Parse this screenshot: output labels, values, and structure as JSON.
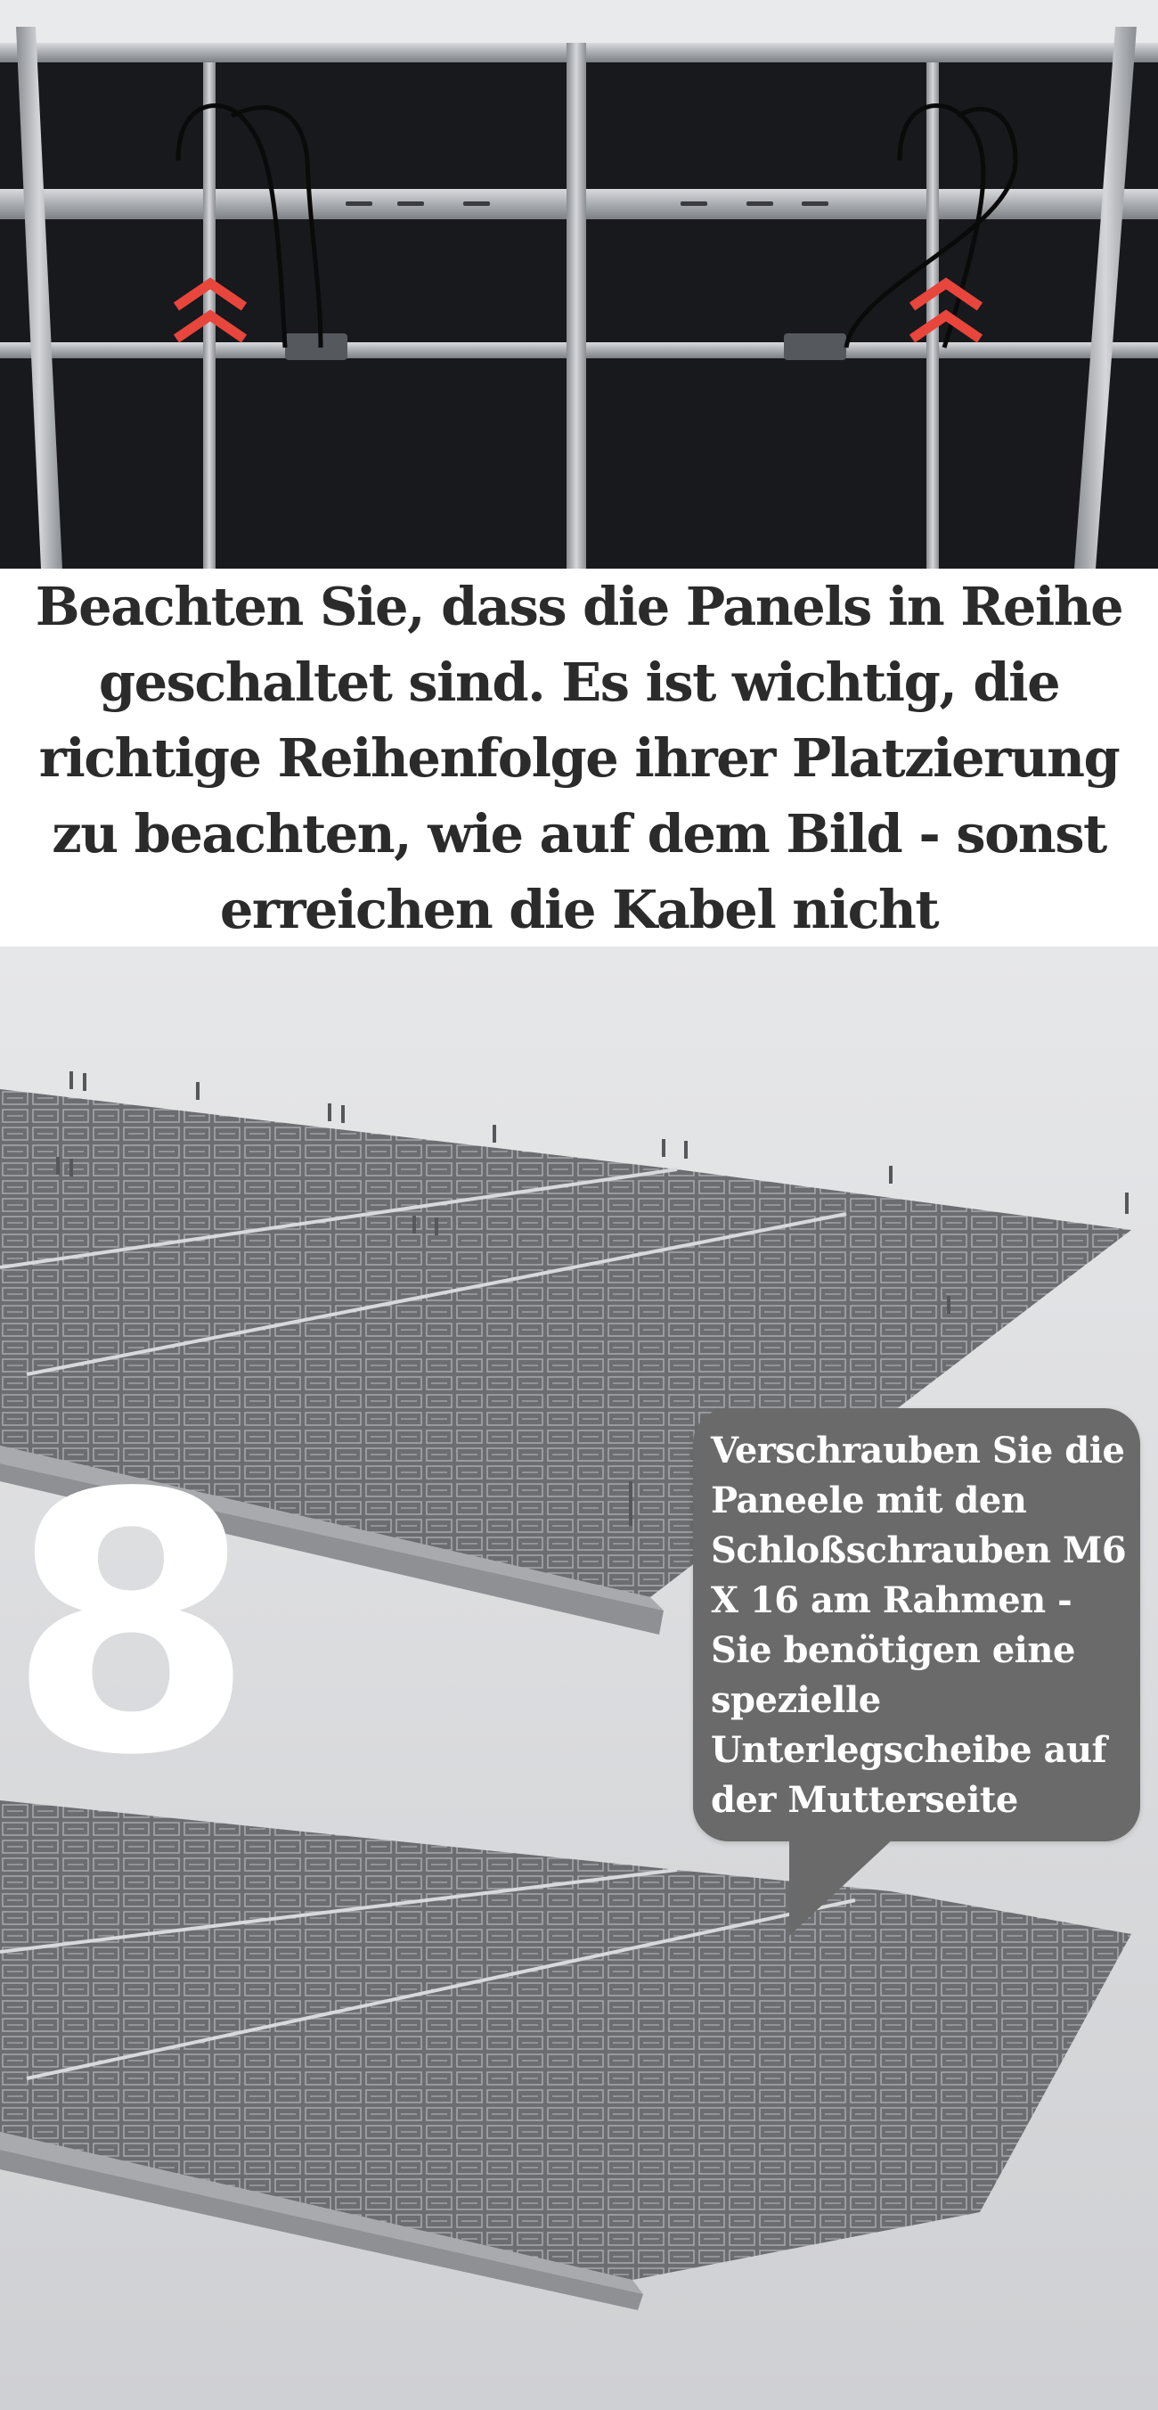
{
  "caption": {
    "text": "Beachten Sie, dass die Panels in Reihe geschaltet sind. Es ist wichtig, die richtige Reihenfolge ihrer Platzierung zu beachten, wie auf dem Bild - sonst erreichen die Kabel nicht"
  },
  "step": {
    "number": "8",
    "instruction": "Verschrauben Sie die Paneele mit den Schloßschrauben M6 X 16 am Rahmen - Sie benötigen eine spezielle Unterlegscheibe auf der Mutterseite"
  },
  "colors": {
    "arrow_accent": "#e8453c",
    "callout_background": "#6a6a6a",
    "caption_text": "#2b2b2b",
    "panel_back": "#16181b",
    "frame_aluminium": "#b9bcc0"
  },
  "icons": {
    "top_left_marker": "double-chevron-up-icon",
    "top_right_marker": "double-chevron-up-icon"
  }
}
